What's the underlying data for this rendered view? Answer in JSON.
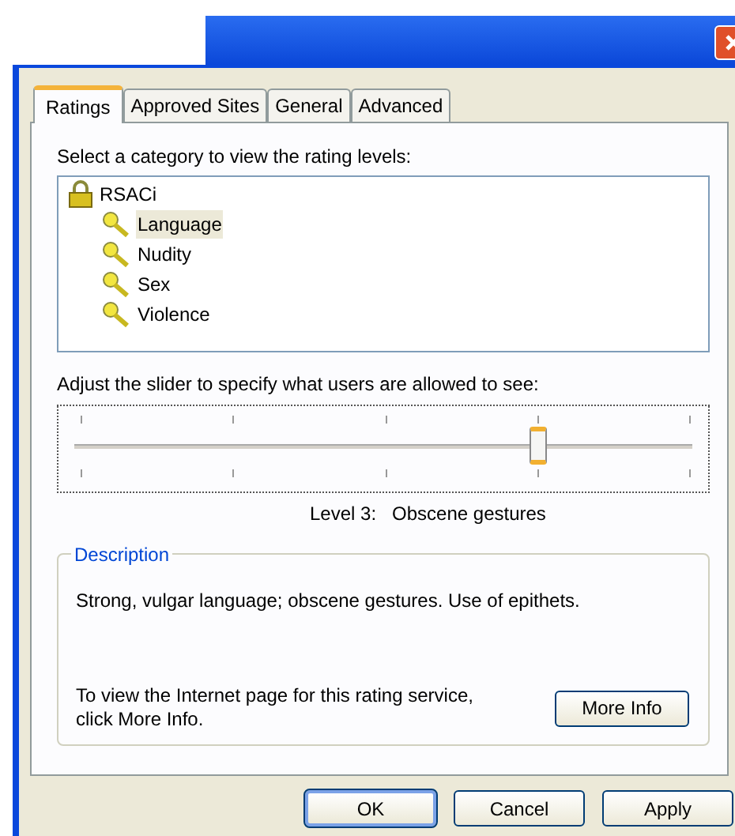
{
  "tabs": [
    {
      "label": "Ratings",
      "selected": true
    },
    {
      "label": "Approved Sites",
      "selected": false
    },
    {
      "label": "General",
      "selected": false
    },
    {
      "label": "Advanced",
      "selected": false
    }
  ],
  "category_label": "Select a category to view the rating levels:",
  "tree": {
    "label": "RSACi",
    "children": [
      {
        "label": "Language",
        "selected": true
      },
      {
        "label": "Nudity",
        "selected": false
      },
      {
        "label": "Sex",
        "selected": false
      },
      {
        "label": "Violence",
        "selected": false
      }
    ]
  },
  "slider_label": "Adjust the slider to specify what users are allowed to see:",
  "slider": {
    "level": 0.75
  },
  "level_text": "Level 3:   Obscene gestures",
  "description": {
    "legend": "Description",
    "text": "Strong, vulgar language; obscene gestures. Use of epithets.",
    "info_text": "To view the Internet page for this rating service, click More Info.",
    "button": "More Info"
  },
  "buttons": [
    {
      "label": "OK",
      "default": true
    },
    {
      "label": "Cancel",
      "default": false
    },
    {
      "label": "Apply",
      "default": false
    }
  ]
}
